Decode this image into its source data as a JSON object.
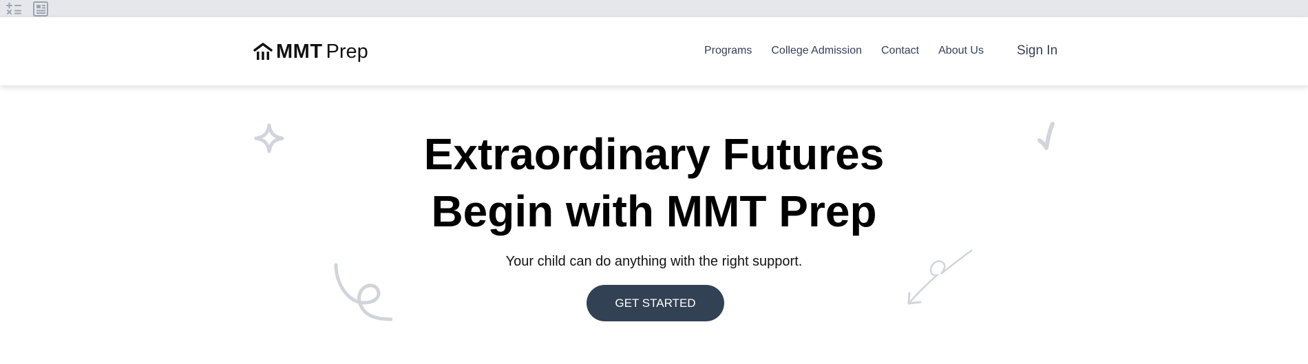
{
  "topbar": {
    "icons": [
      "calculator-icon",
      "newspaper-icon"
    ]
  },
  "nav": {
    "logo": {
      "bold": "MMT",
      "light": "Prep",
      "icon": "building-icon"
    },
    "links": [
      "Programs",
      "College Admission",
      "Contact",
      "About Us"
    ],
    "sign_in": "Sign In"
  },
  "hero": {
    "title_line1": "Extraordinary Futures",
    "title_line2": "Begin with MMT Prep",
    "subtitle": "Your child can do anything with the right support.",
    "cta": "GET STARTED"
  },
  "colors": {
    "topbar_bg": "#e5e7eb",
    "nav_text": "#334155",
    "cta_bg": "#334155",
    "cta_text": "#ffffff",
    "decoration": "#d1d5db"
  }
}
